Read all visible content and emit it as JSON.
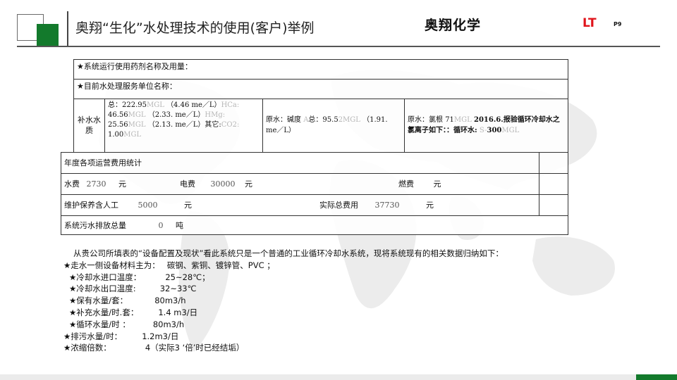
{
  "header": {
    "title": "奥翔“生化”水处理技术的使用(客户)举例",
    "brand": "奥翔化学",
    "code": "LT",
    "page": "P9"
  },
  "colors": {
    "accent_green": "#137a2c",
    "code_red": "#e0141b"
  },
  "table": {
    "row_system_agents": "★系统运行使用药剂名称及用量：",
    "row_service_unit": "★目前水处理服务单位名称：",
    "makeup_label": "补水水质",
    "makeup_hardness_a": "总：222.95",
    "makeup_hardness_b": "MGL",
    "makeup_hardness_c": "（4.46 me／L）",
    "makeup_hardness_d": "HCa:",
    "makeup_hardness_e": "46.56",
    "makeup_hardness_f": "MGL",
    "makeup_hardness_g": "（2.33. me／L）",
    "makeup_hardness_h": "HMg:",
    "makeup_hardness_i": "25.56",
    "makeup_hardness_j": "MGL",
    "makeup_hardness_k": "（2.13. me／L）其它:",
    "makeup_hardness_l": "CO2:",
    "makeup_hardness_m": "1.00",
    "makeup_hardness_n": "MGL",
    "raw_alk_a": "原水：碱度",
    "raw_alk_b": "A",
    "raw_alk_c": "总：95.5",
    "raw_alk_d": "2MGL",
    "raw_alk_e": "（1.91.",
    "raw_alk_f": "me／L）",
    "raw_cl_a": "原水：氯根",
    "raw_cl_b": "71",
    "raw_cl_c": "MGL",
    "raw_cl_d": "2016.6.",
    "raw_cl_e": "报验循环冷却水之氯离子如下：：循环水:",
    "raw_cl_f": "S-",
    "raw_cl_g": "300",
    "raw_cl_h": "MGL",
    "annual_cost_title": "年度各项运营费用统计",
    "water_fee_label": "水费",
    "water_fee_value": "2730",
    "unit_yuan": "元",
    "electric_fee_label": "电费",
    "electric_fee_value": "30000",
    "fuel_fee_label": "燃费",
    "maintenance_label": "维护保养含人工",
    "maintenance_value": "5000",
    "total_label": "实际总费用",
    "total_value": "37730",
    "sewage_label": "系统污水排放总量",
    "sewage_value": "0",
    "sewage_unit": "吨"
  },
  "notes": {
    "intro": "从贵公司所填表的“设备配置及现状”看此系统只是一个普通的工业循环冷却水系统，现将系统现有的相关数据归纳如下：",
    "items": [
      {
        "label": "★走水一侧设备材料主为：",
        "value": "碳钢、紫铜、镀锌管、PVC ；"
      },
      {
        "label": "★冷却水进口温度：",
        "value": "25~28℃；"
      },
      {
        "label": "★冷却水出口温度:",
        "value": "32~33℃"
      },
      {
        "label": "★保有水量/套：",
        "value": "80m3/h"
      },
      {
        "label": "★补充水量/时.套：",
        "value": "1.4 m3/日"
      },
      {
        "label": "★循环水量/时 ：",
        "value": "80m3/h"
      },
      {
        "label": "★排污水量/时：",
        "value": "1.2m3/日"
      },
      {
        "label": "★浓缩倍数：",
        "value": "4（实际3 ‘倍’时已经结垢）"
      }
    ]
  }
}
